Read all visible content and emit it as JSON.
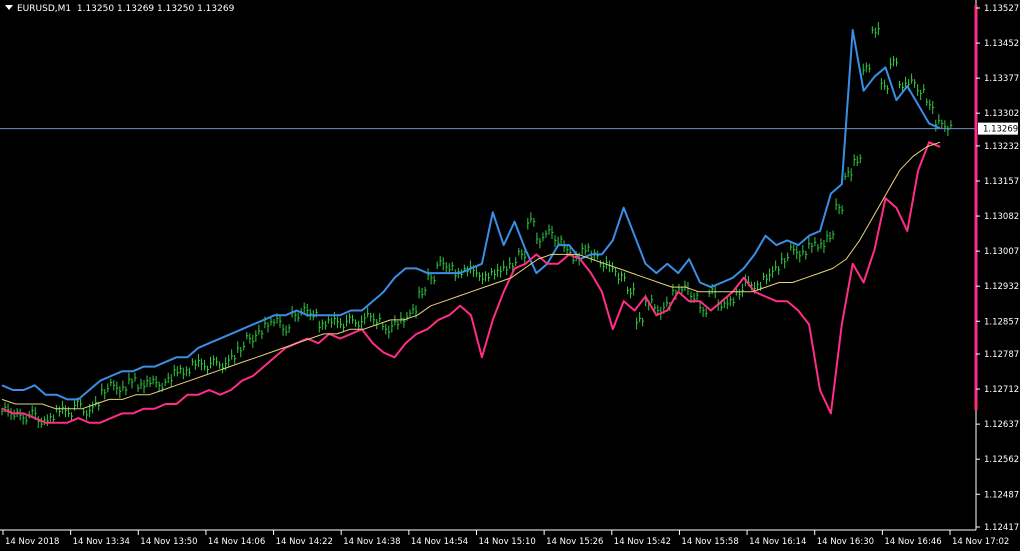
{
  "header": {
    "symbol": "EURUSD,M1",
    "ohlc": "1.13250 1.13269 1.13250 1.13269"
  },
  "current_price_label": "1.13269",
  "colors": {
    "background": "#000000",
    "axis": "#ffffff",
    "bars": "#2ecc40",
    "upper_line": "#3a8ee6",
    "lower_line": "#ff2d86",
    "moving_average": "#e8d27a",
    "current_price_line": "#6a8fc0",
    "scale_bar": "#ff2d86"
  },
  "chart_data": {
    "type": "line",
    "title": "EURUSD,M1",
    "y_ticks": [
      "1.13527",
      "1.13452",
      "1.13377",
      "1.13302",
      "1.13232",
      "1.13157",
      "1.13082",
      "1.13007",
      "1.12932",
      "1.12857",
      "1.12787",
      "1.12712",
      "1.12637",
      "1.12562",
      "1.12487",
      "1.12417"
    ],
    "x_ticks": [
      "14 Nov 2018",
      "14 Nov 13:34",
      "14 Nov 13:50",
      "14 Nov 14:06",
      "14 Nov 14:22",
      "14 Nov 14:38",
      "14 Nov 14:54",
      "14 Nov 15:10",
      "14 Nov 15:26",
      "14 Nov 15:42",
      "14 Nov 15:58",
      "14 Nov 16:14",
      "14 Nov 16:30",
      "14 Nov 16:46",
      "14 Nov 17:02"
    ],
    "ylim": [
      1.12417,
      1.13527
    ],
    "current_price": 1.13269,
    "series": [
      {
        "role": "price",
        "values": [
          1.1267,
          1.1266,
          1.1265,
          1.1266,
          1.1264,
          1.1265,
          1.1267,
          1.1266,
          1.1268,
          1.1266,
          1.1268,
          1.1271,
          1.1272,
          1.1271,
          1.1273,
          1.1272,
          1.1273,
          1.1272,
          1.1273,
          1.1275,
          1.1275,
          1.1277,
          1.1276,
          1.1277,
          1.1276,
          1.1278,
          1.128,
          1.1282,
          1.1283,
          1.1285,
          1.1286,
          1.1284,
          1.1287,
          1.1288,
          1.1287,
          1.1285,
          1.1286,
          1.1285,
          1.1286,
          1.1285,
          1.1287,
          1.1286,
          1.1284,
          1.1285,
          1.1286,
          1.1288,
          1.1292,
          1.1295,
          1.1298,
          1.1297,
          1.1296,
          1.1297,
          1.1296,
          1.1295,
          1.1296,
          1.1297,
          1.1298,
          1.13,
          1.1307,
          1.1303,
          1.1305,
          1.1303,
          1.1301,
          1.1299,
          1.1301,
          1.13,
          1.1298,
          1.1297,
          1.1295,
          1.1292,
          1.1286,
          1.129,
          1.1288,
          1.1289,
          1.1292,
          1.1293,
          1.1291,
          1.1288,
          1.1292,
          1.1289,
          1.129,
          1.1292,
          1.1294,
          1.1293,
          1.1295,
          1.1297,
          1.1299,
          1.1301,
          1.13,
          1.1302,
          1.1302,
          1.1304,
          1.131,
          1.1317,
          1.132,
          1.134,
          1.1348,
          1.1336,
          1.1341,
          1.1336,
          1.1337,
          1.1335,
          1.1332,
          1.1328,
          1.1327
        ]
      },
      {
        "role": "upper",
        "values": [
          1.1272,
          1.1271,
          1.1271,
          1.1272,
          1.127,
          1.127,
          1.1269,
          1.1269,
          1.1271,
          1.1273,
          1.1274,
          1.1275,
          1.1275,
          1.1276,
          1.1276,
          1.1277,
          1.1278,
          1.1278,
          1.128,
          1.1281,
          1.1282,
          1.1283,
          1.1284,
          1.1285,
          1.1286,
          1.1287,
          1.1287,
          1.1288,
          1.1287,
          1.1287,
          1.1287,
          1.1287,
          1.1288,
          1.1288,
          1.129,
          1.1292,
          1.1295,
          1.1297,
          1.1297,
          1.1296,
          1.1296,
          1.1296,
          1.1296,
          1.1297,
          1.1298,
          1.1309,
          1.1302,
          1.1307,
          1.1301,
          1.1296,
          1.1298,
          1.1302,
          1.1302,
          1.1299,
          1.13,
          1.13,
          1.1303,
          1.131,
          1.1304,
          1.1298,
          1.1296,
          1.1298,
          1.1296,
          1.1299,
          1.1294,
          1.1293,
          1.1294,
          1.1295,
          1.1297,
          1.13,
          1.1304,
          1.1302,
          1.1303,
          1.1302,
          1.1304,
          1.1305,
          1.1313,
          1.1315,
          1.1348,
          1.1335,
          1.1338,
          1.134,
          1.1333,
          1.1336,
          1.1332,
          1.1328,
          1.1327
        ]
      },
      {
        "role": "lower",
        "values": [
          1.1267,
          1.1266,
          1.1266,
          1.1265,
          1.1264,
          1.1264,
          1.1264,
          1.1265,
          1.1264,
          1.1264,
          1.1265,
          1.1266,
          1.1266,
          1.1267,
          1.1267,
          1.1268,
          1.1268,
          1.127,
          1.127,
          1.1271,
          1.127,
          1.1271,
          1.1273,
          1.1274,
          1.1276,
          1.1278,
          1.128,
          1.1281,
          1.1282,
          1.1281,
          1.1283,
          1.1282,
          1.1283,
          1.1284,
          1.1281,
          1.1279,
          1.1278,
          1.1281,
          1.1283,
          1.1284,
          1.1286,
          1.1287,
          1.1289,
          1.1287,
          1.1278,
          1.1286,
          1.1292,
          1.1297,
          1.1298,
          1.13,
          1.1298,
          1.1298,
          1.13,
          1.1299,
          1.1296,
          1.1292,
          1.1284,
          1.129,
          1.1288,
          1.1291,
          1.1287,
          1.1288,
          1.1292,
          1.129,
          1.129,
          1.1288,
          1.129,
          1.1292,
          1.1295,
          1.1292,
          1.1291,
          1.129,
          1.129,
          1.1288,
          1.1285,
          1.1271,
          1.1266,
          1.1285,
          1.1298,
          1.1294,
          1.1301,
          1.1312,
          1.131,
          1.1305,
          1.1318,
          1.1324,
          1.1323
        ]
      },
      {
        "role": "ma",
        "values": [
          1.1269,
          1.1268,
          1.1268,
          1.1268,
          1.1267,
          1.1267,
          1.1267,
          1.1268,
          1.1269,
          1.1269,
          1.127,
          1.127,
          1.1271,
          1.1272,
          1.1273,
          1.1274,
          1.1275,
          1.1276,
          1.1277,
          1.1278,
          1.1279,
          1.128,
          1.1281,
          1.1282,
          1.1283,
          1.1283,
          1.1284,
          1.1284,
          1.1285,
          1.1286,
          1.1286,
          1.1287,
          1.1289,
          1.129,
          1.1291,
          1.1292,
          1.1293,
          1.1294,
          1.1295,
          1.1297,
          1.1299,
          1.13,
          1.13,
          1.13,
          1.1299,
          1.1298,
          1.1297,
          1.1296,
          1.1295,
          1.1294,
          1.1293,
          1.1293,
          1.1292,
          1.1292,
          1.1292,
          1.1292,
          1.1292,
          1.1293,
          1.1294,
          1.1294,
          1.1295,
          1.1296,
          1.1297,
          1.1299,
          1.1303,
          1.1308,
          1.1313,
          1.1318,
          1.1321,
          1.1323,
          1.1324
        ]
      }
    ]
  }
}
